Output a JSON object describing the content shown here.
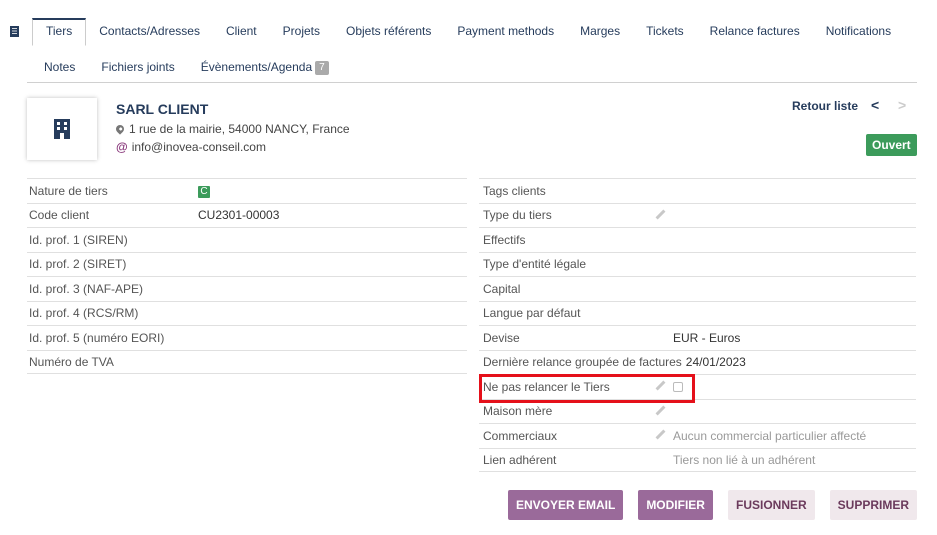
{
  "tabs_row1": [
    "Tiers",
    "Contacts/Adresses",
    "Client",
    "Projets",
    "Objets référents",
    "Payment methods",
    "Marges",
    "Tickets",
    "Relance factures",
    "Notifications"
  ],
  "tabs_row2": [
    "Notes",
    "Fichiers joints",
    "Évènements/Agenda"
  ],
  "events_count": "7",
  "company": {
    "name": "SARL CLIENT",
    "address": "1 rue de la mairie, 54000 NANCY, France",
    "email": "info@inovea-conseil.com"
  },
  "nav": {
    "back_label": "Retour liste",
    "prev": "<",
    "next": ">"
  },
  "status": "Ouvert",
  "left_fields": [
    {
      "label": "Nature de tiers",
      "value": "C"
    },
    {
      "label": "Code client",
      "value": "CU2301-00003"
    },
    {
      "label": "Id. prof. 1 (SIREN)",
      "value": ""
    },
    {
      "label": "Id. prof. 2 (SIRET)",
      "value": ""
    },
    {
      "label": "Id. prof. 3 (NAF-APE)",
      "value": ""
    },
    {
      "label": "Id. prof. 4 (RCS/RM)",
      "value": ""
    },
    {
      "label": "Id. prof. 5 (numéro EORI)",
      "value": ""
    },
    {
      "label": "Numéro de TVA",
      "value": ""
    }
  ],
  "right_fields": [
    {
      "label": "Tags clients",
      "value": ""
    },
    {
      "label": "Type du tiers",
      "value": ""
    },
    {
      "label": "Effectifs",
      "value": ""
    },
    {
      "label": "Type d'entité légale",
      "value": ""
    },
    {
      "label": "Capital",
      "value": ""
    },
    {
      "label": "Langue par défaut",
      "value": ""
    },
    {
      "label": "Devise",
      "value": "EUR - Euros"
    },
    {
      "label": "Dernière relance groupée de factures",
      "value": "24/01/2023"
    },
    {
      "label": "Ne pas relancer le Tiers",
      "value": ""
    },
    {
      "label": "Maison mère",
      "value": ""
    },
    {
      "label": "Commerciaux",
      "value": "Aucun commercial particulier affecté"
    },
    {
      "label": "Lien adhérent",
      "value": "Tiers non lié à un adhérent"
    }
  ],
  "buttons": {
    "send_email": "ENVOYER EMAIL",
    "modify": "MODIFIER",
    "merge": "FUSIONNER",
    "delete": "SUPPRIMER"
  },
  "colors": {
    "nav": "#263c5c",
    "status_green": "#3c9b5b",
    "primary_button": "#9a6a9a",
    "highlight_red": "#e5101a"
  }
}
